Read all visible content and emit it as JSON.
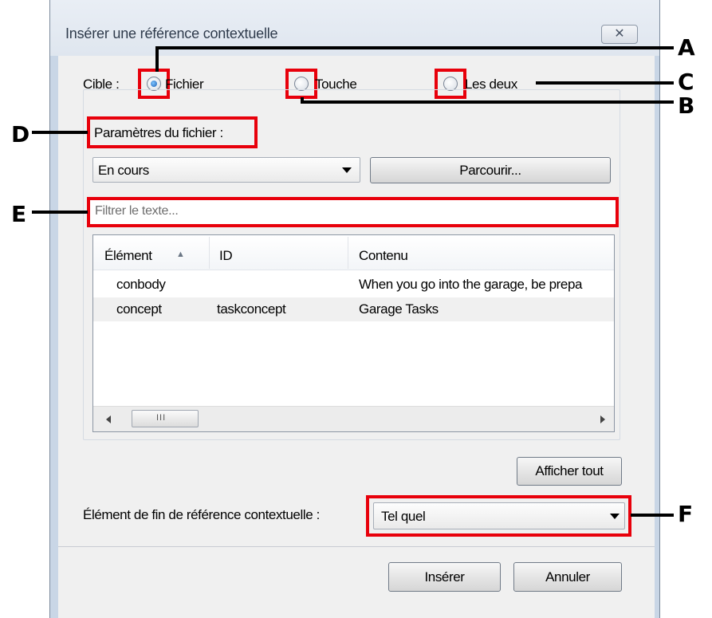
{
  "dialog": {
    "title": "Insérer une référence contextuelle",
    "close_glyph": "✕",
    "target_label": "Cible :",
    "radios": [
      {
        "label": "Fichier",
        "checked": true
      },
      {
        "label": "Touche",
        "checked": false
      },
      {
        "label": "Les deux",
        "checked": false
      }
    ],
    "file_params_label": "Paramètres du fichier :",
    "scope_combo_value": "En cours",
    "browse_button": "Parcourir...",
    "filter_placeholder": "Filtrer le texte...",
    "columns": [
      "Élément",
      "ID",
      "Contenu"
    ],
    "sort_indicator": "▲",
    "rows": [
      {
        "element": "conbody",
        "id": "",
        "content": "When you go into the garage, be prepa"
      },
      {
        "element": "concept",
        "id": "taskconcept",
        "content": "Garage Tasks"
      }
    ],
    "scroll_thumb_grip": "III",
    "show_all_button": "Afficher tout",
    "end_element_label": "Élément de fin de référence contextuelle :",
    "end_element_value": "Tel quel",
    "insert_button": "Insérer",
    "cancel_button": "Annuler"
  },
  "callouts": [
    "A",
    "B",
    "C",
    "D",
    "E",
    "F"
  ],
  "colors": {
    "highlight": "#e8000b",
    "selected_row": "#f0f0f0"
  }
}
